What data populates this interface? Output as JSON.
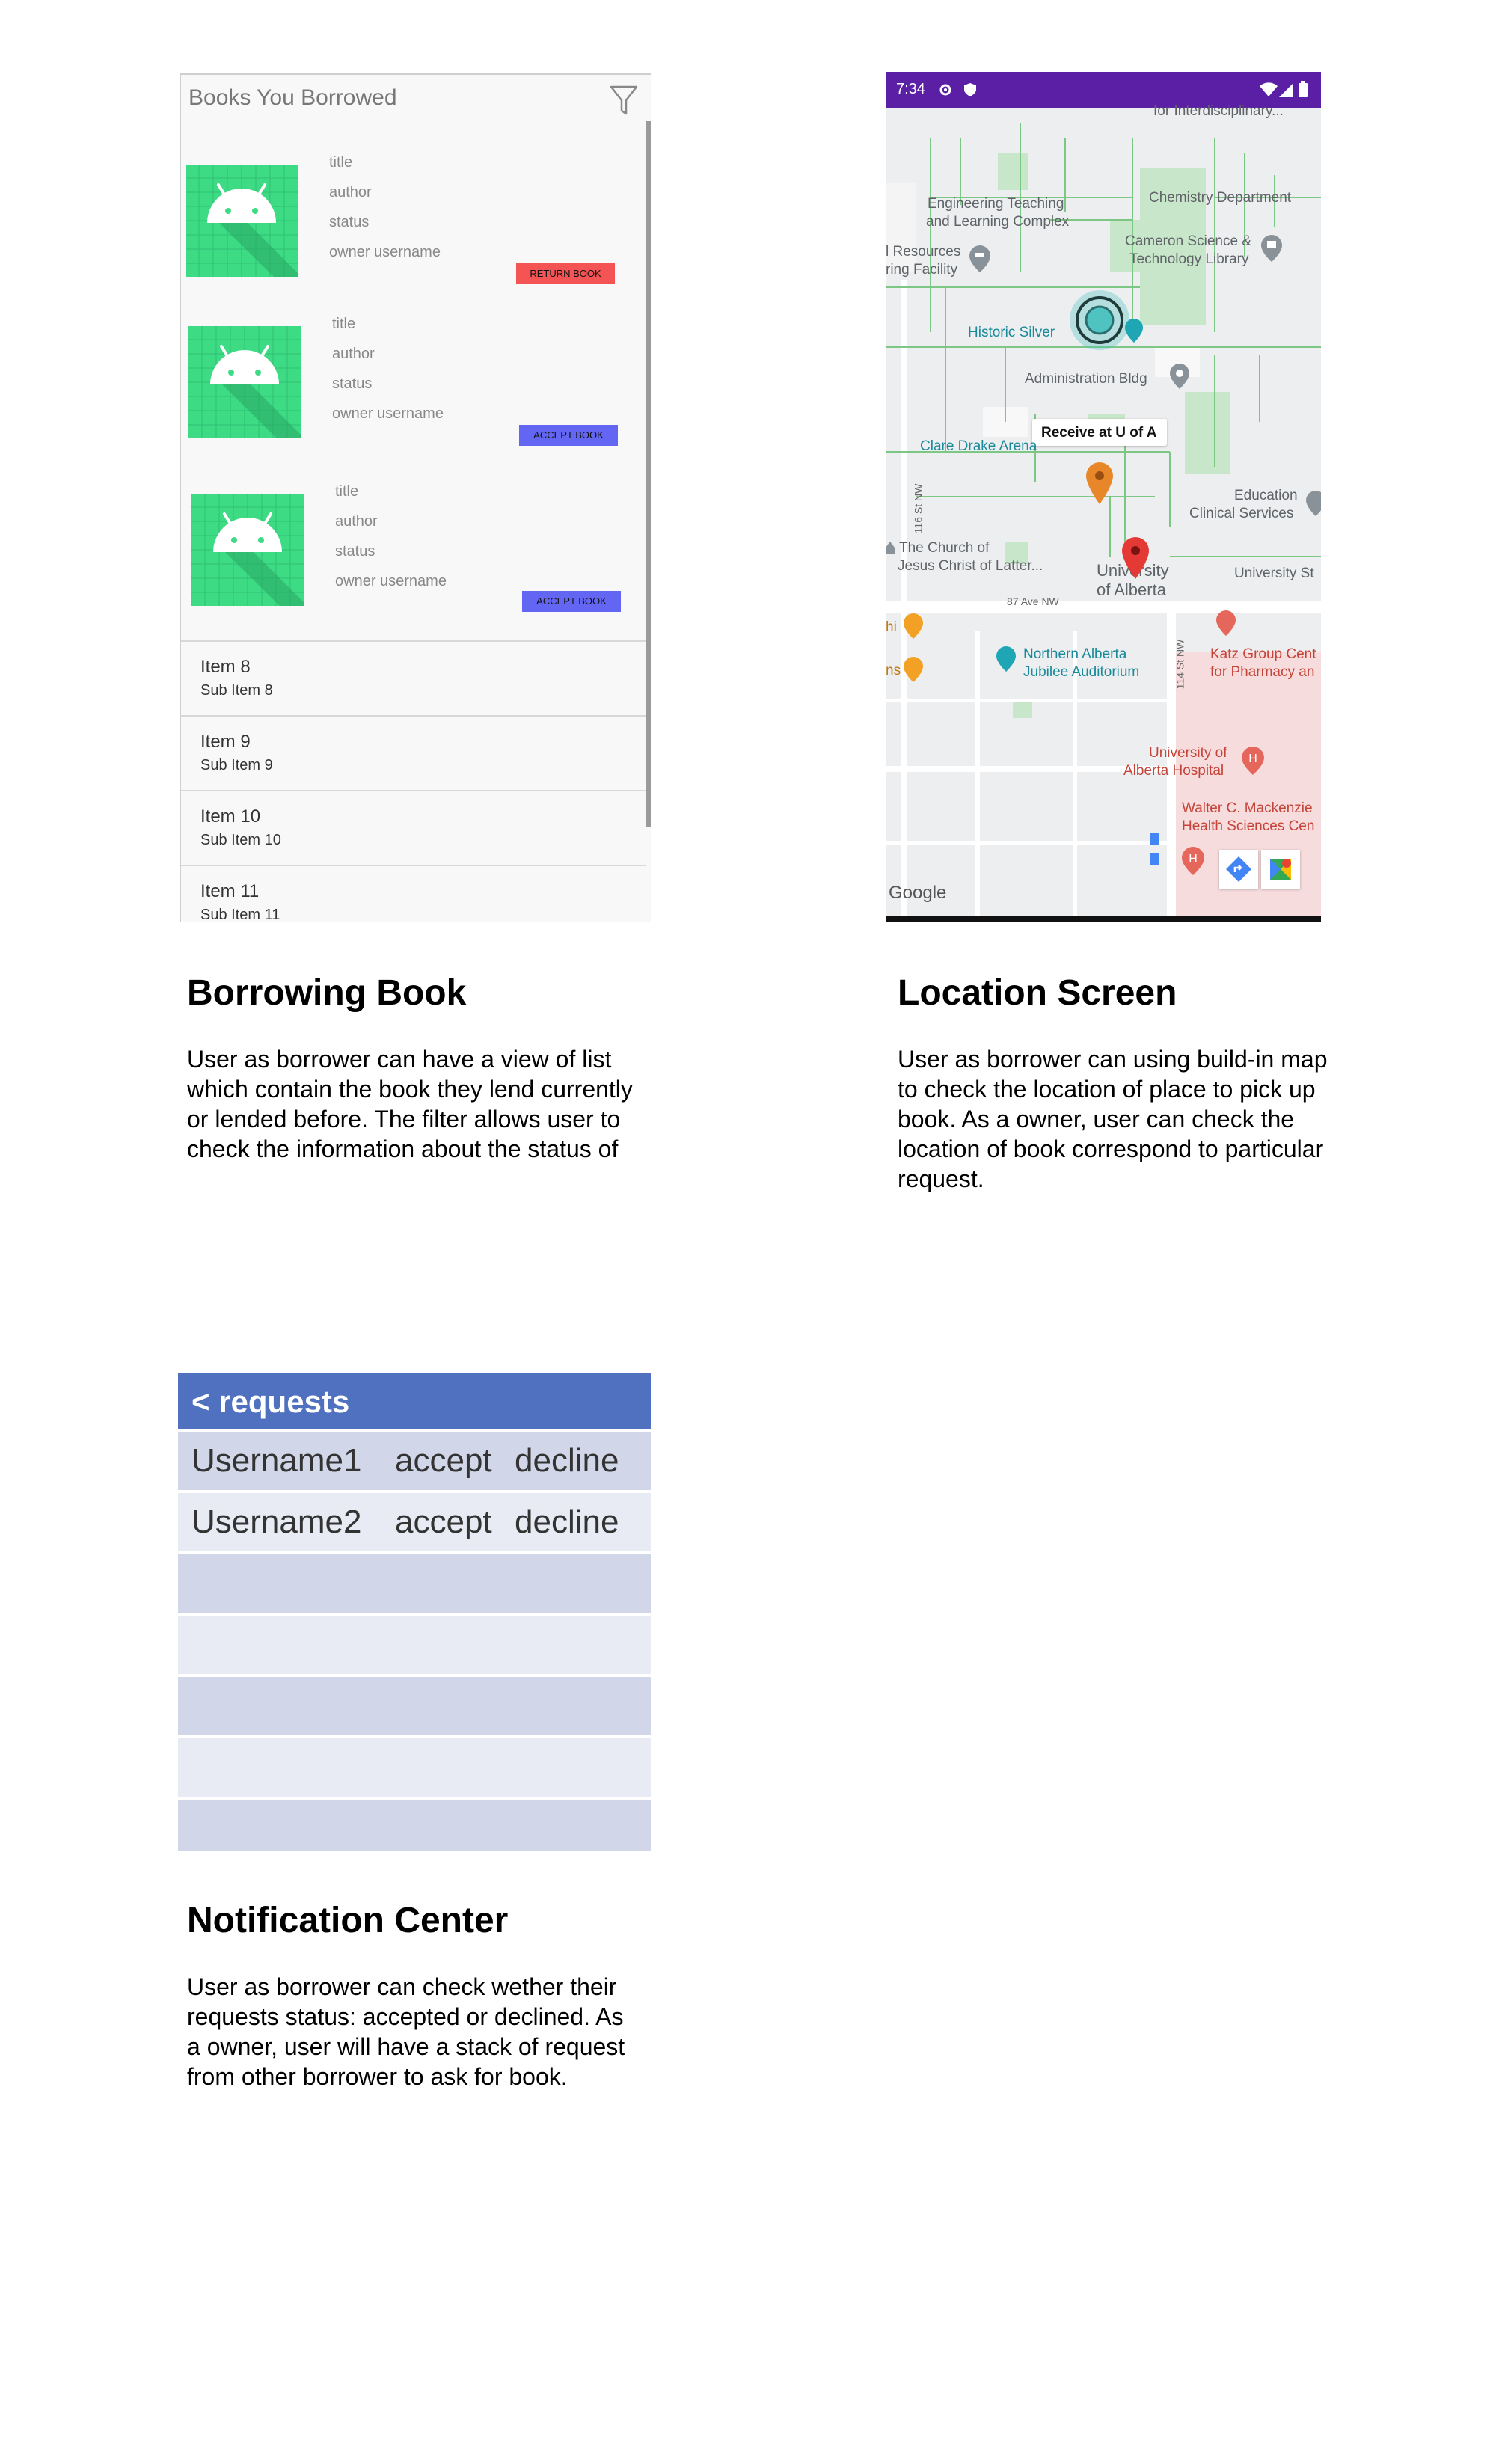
{
  "borrow": {
    "title": "Books You Borrowed",
    "books": [
      {
        "title": "title",
        "author": "author",
        "status": "status",
        "owner": "owner username",
        "button": "RETURN BOOK",
        "button_color": "#f55454"
      },
      {
        "title": "title",
        "author": "author",
        "status": "status",
        "owner": "owner username",
        "button": "ACCEPT BOOK",
        "button_color": "#6366f2"
      },
      {
        "title": "title",
        "author": "author",
        "status": "status",
        "owner": "owner username",
        "button": "ACCEPT BOOK",
        "button_color": "#6366f2"
      }
    ],
    "items": [
      {
        "main": "Item 8",
        "sub": "Sub Item 8"
      },
      {
        "main": "Item 9",
        "sub": "Sub Item 9"
      },
      {
        "main": "Item 10",
        "sub": "Sub Item 10"
      },
      {
        "main": "Item 11",
        "sub": "Sub Item 11"
      }
    ]
  },
  "map": {
    "status_time": "7:34",
    "labels": {
      "interdisciplinary": "for Interdisciplinary...",
      "engineering": "Engineering Teaching",
      "engineering2": "and Learning Complex",
      "chemistry": "Chemistry Department",
      "resources": "l Resources",
      "resources2": "ring Facility",
      "cameron": "Cameron Science &",
      "cameron2": "Technology Library",
      "historic": "Historic Silver",
      "admin": "Administration Bldg",
      "receive": "Receive at U of A",
      "clare": "Clare Drake Arena",
      "education": "Education",
      "education2": "Clinical Services",
      "church": "The Church of",
      "church2": "Jesus Christ of Latter...",
      "uofa": "University",
      "uofa2": "of Alberta",
      "university_st": "University St",
      "ave87": "87 Ave NW",
      "st116": "116 St NW",
      "st114": "114 St NW",
      "jubilee": "Northern Alberta",
      "jubilee2": "Jubilee Auditorium",
      "katz": "Katz Group Cent",
      "katz2": "for Pharmacy an",
      "hospital": "University of",
      "hospital2": "Alberta Hospital",
      "walter": "Walter C. Mackenzie",
      "walter2": "Health Sciences Cen",
      "hi": "hi",
      "ns": "ns",
      "google": "Google"
    }
  },
  "requests": {
    "header": "< requests",
    "rows": [
      {
        "user": "Username1",
        "accept": "accept",
        "decline": "decline"
      },
      {
        "user": "Username2",
        "accept": "accept",
        "decline": "decline"
      },
      {
        "user": "",
        "accept": "",
        "decline": ""
      },
      {
        "user": "",
        "accept": "",
        "decline": ""
      },
      {
        "user": "",
        "accept": "",
        "decline": ""
      },
      {
        "user": "",
        "accept": "",
        "decline": ""
      },
      {
        "user": "",
        "accept": "",
        "decline": ""
      }
    ],
    "row_colors": [
      "#d1d6e8",
      "#e8ebf4"
    ],
    "header_color": "#4f71bf"
  },
  "sections": {
    "borrowing": {
      "heading": "Borrowing Book",
      "desc": [
        "User as borrower can have a view of list",
        "which contain the book they lend currently",
        "or lended before. The filter allows user to",
        "check the information about the status of"
      ]
    },
    "location": {
      "heading": "Location Screen",
      "desc": [
        "User as borrower can using build-in map",
        "to check the location of place to pick up",
        "book. As a owner, user can check the",
        "location of book correspond to particular",
        "request."
      ]
    },
    "notification": {
      "heading": "Notification Center",
      "desc": [
        "User as borrower can check wether their",
        "requests status: accepted or declined. As",
        "a owner, user will have a stack of request",
        "from other borrower to ask for book."
      ]
    }
  }
}
